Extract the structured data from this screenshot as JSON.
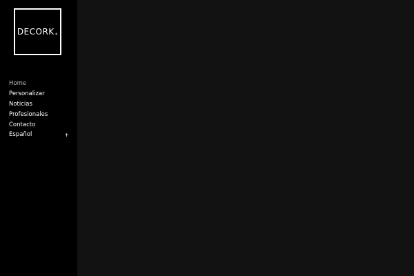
{
  "logo": {
    "text": "DECORK",
    "mark": "®"
  },
  "nav": {
    "items": [
      {
        "label": "Home",
        "active": true
      },
      {
        "label": "Personalizar",
        "active": false
      },
      {
        "label": "Noticias",
        "active": false
      },
      {
        "label": "Profesionales",
        "active": false
      },
      {
        "label": "Contacto",
        "active": false
      }
    ],
    "language": {
      "label": "Español",
      "toggle": "+"
    }
  },
  "colors": {
    "sidebar_bg": "#000000",
    "main_bg": "#121212",
    "text": "#ffffff",
    "active_text": "#bcbcbc"
  }
}
